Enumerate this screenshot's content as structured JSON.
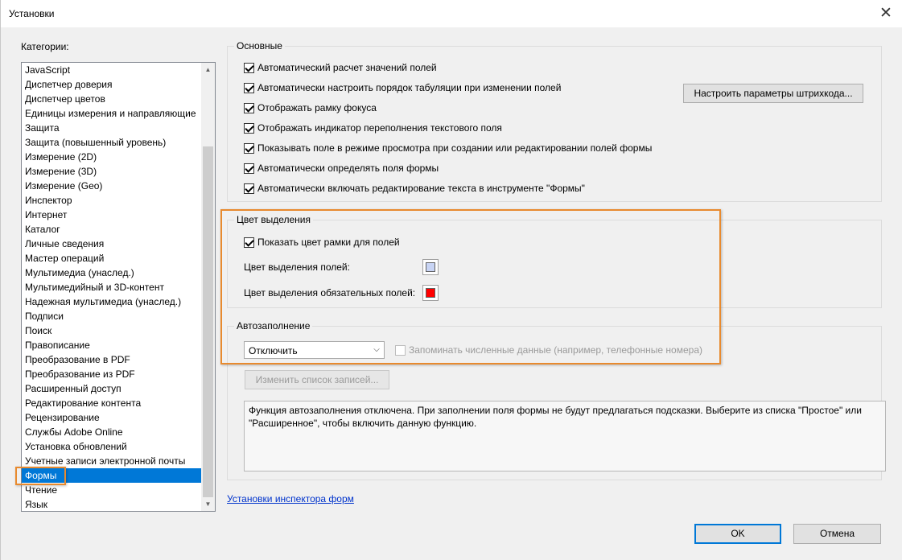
{
  "window": {
    "title": "Установки"
  },
  "categories": {
    "label": "Категории:",
    "items": [
      "JavaScript",
      "Диспетчер доверия",
      "Диспетчер цветов",
      "Единицы измерения и направляющие",
      "Защита",
      "Защита (повышенный уровень)",
      "Измерение (2D)",
      "Измерение (3D)",
      "Измерение (Geo)",
      "Инспектор",
      "Интернет",
      "Каталог",
      "Личные сведения",
      "Мастер операций",
      "Мультимедиа (унаслед.)",
      "Мультимедийный и 3D-контент",
      "Надежная мультимедиа (унаслед.)",
      "Подписи",
      "Поиск",
      "Правописание",
      "Преобразование в PDF",
      "Преобразование из PDF",
      "Расширенный доступ",
      "Редактирование контента",
      "Рецензирование",
      "Службы Adobe Online",
      "Установка обновлений",
      "Учетные записи электронной почты",
      "Формы",
      "Чтение",
      "Язык"
    ],
    "selected_index": 28
  },
  "general": {
    "title": "Основные",
    "options": [
      {
        "label": "Автоматический расчет значений полей",
        "checked": true
      },
      {
        "label": "Автоматически настроить порядок табуляции при изменении полей",
        "checked": true
      },
      {
        "label": "Отображать рамку фокуса",
        "checked": true
      },
      {
        "label": "Отображать индикатор переполнения текстового поля",
        "checked": true
      },
      {
        "label": "Показывать поле в режиме просмотра при создании или редактировании полей формы",
        "checked": true
      },
      {
        "label": "Автоматически определять поля формы",
        "checked": true
      },
      {
        "label": "Автоматически включать редактирование текста в инструменте \"Формы\"",
        "checked": true
      }
    ],
    "barcode_button": "Настроить параметры штрихкода..."
  },
  "highlight": {
    "title": "Цвет выделения",
    "show_border": {
      "label": "Показать цвет рамки для полей",
      "checked": true
    },
    "field_color_label": "Цвет выделения полей:",
    "field_color": "#c8d4f4",
    "required_color_label": "Цвет выделения обязательных полей:",
    "required_color": "#ff0000"
  },
  "autofill": {
    "title": "Автозаполнение",
    "mode": "Отключить",
    "remember_numeric": {
      "label": "Запоминать численные данные (например, телефонные номера)",
      "checked": false
    },
    "edit_list_button": "Изменить список записей...",
    "description": "Функция автозаполнения отключена. При заполнении поля формы не будут предлагаться подсказки. Выберите из списка \"Простое\" или \"Расширенное\", чтобы включить данную функцию."
  },
  "inspector_link": "Установки инспектора форм",
  "buttons": {
    "ok": "OK",
    "cancel": "Отмена"
  },
  "accent_colors": {
    "selection": "#0078d7",
    "highlight_frame": "#e88a2e",
    "link": "#0033cc"
  }
}
